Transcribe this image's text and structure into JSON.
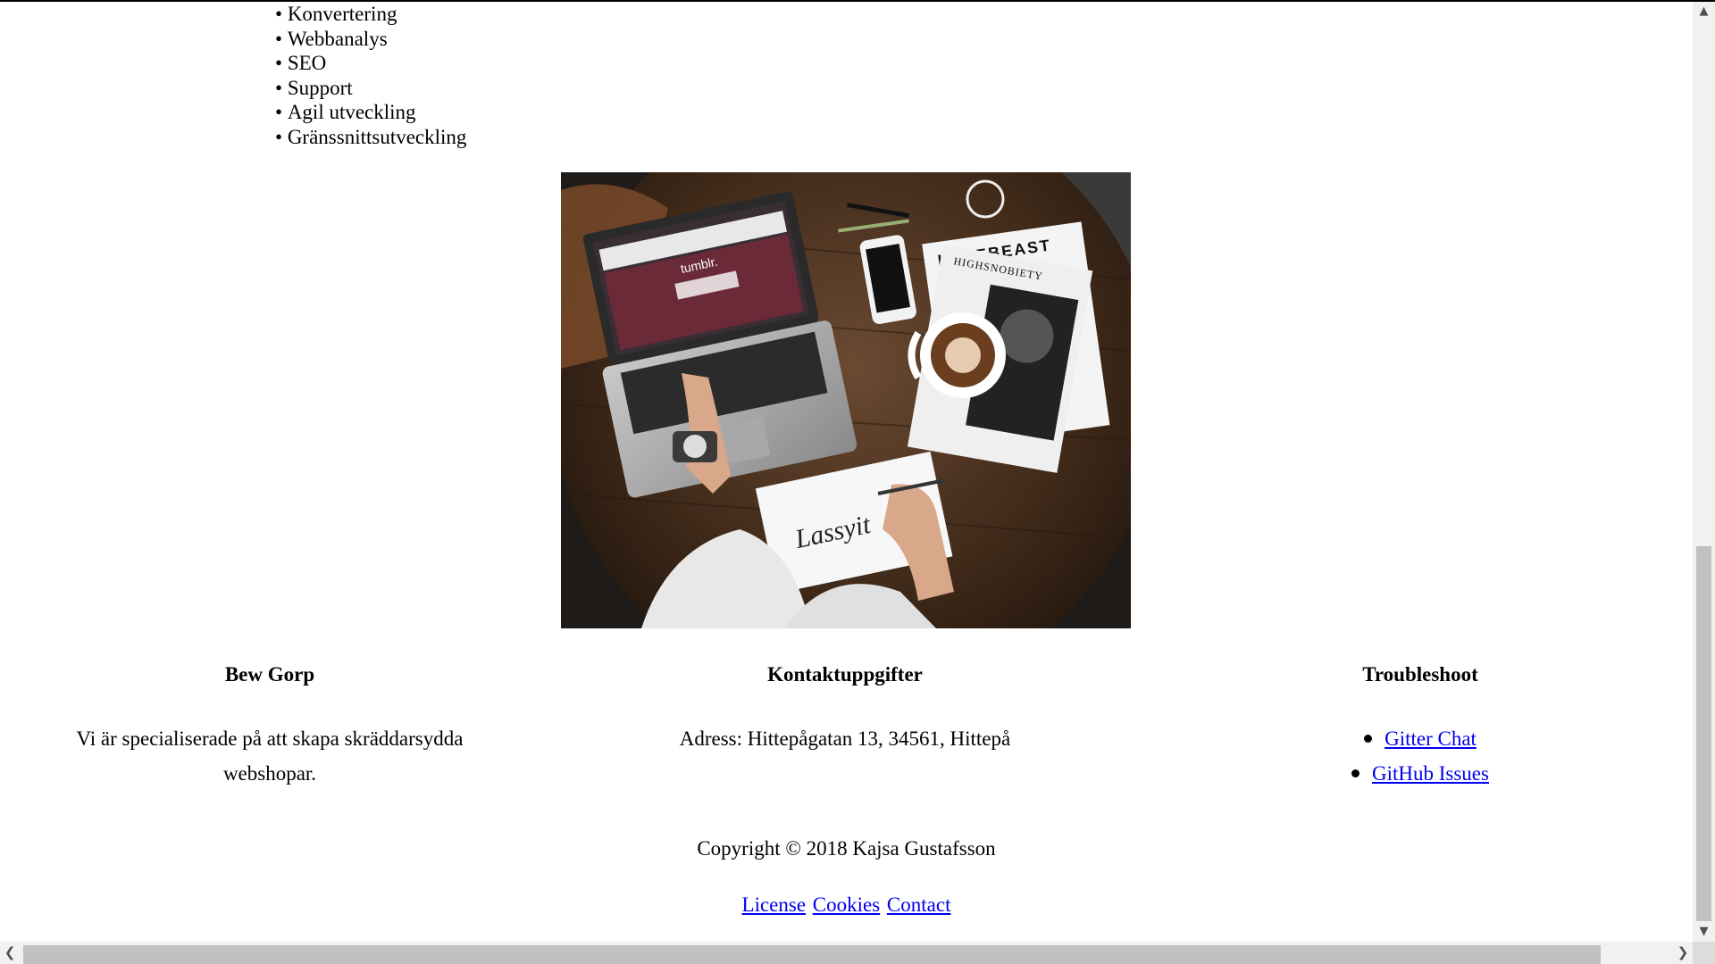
{
  "services": [
    "Konvertering",
    "Webbanalys",
    "SEO",
    "Support",
    "Agil utveckling",
    "Gränssnittsutveckling"
  ],
  "footer": {
    "about": {
      "heading": "Bew Gorp",
      "text": "Vi är specialiserade på att skapa skräddarsydda webshopar."
    },
    "contact": {
      "heading": "Kontaktuppgifter",
      "text": "Adress: Hittepågatan 13, 34561, Hittepå"
    },
    "troubleshoot": {
      "heading": "Troubleshoot",
      "links": [
        "Gitter Chat",
        "GitHub Issues"
      ]
    },
    "copyright": "Copyright © 2018 Kajsa Gustafsson",
    "links": {
      "license": "License",
      "cookies": "Cookies",
      "contact": "Contact"
    }
  },
  "hero_image": {
    "magazine_title_1": "HYPEBEAST",
    "magazine_title_2": "HIGHSNOBIETY",
    "laptop_screen_text": "tumblr.",
    "sketchbook_text": "Lassyit"
  },
  "scrollbars": {
    "vertical_position": 0.6,
    "horizontal_position": 0.0
  }
}
